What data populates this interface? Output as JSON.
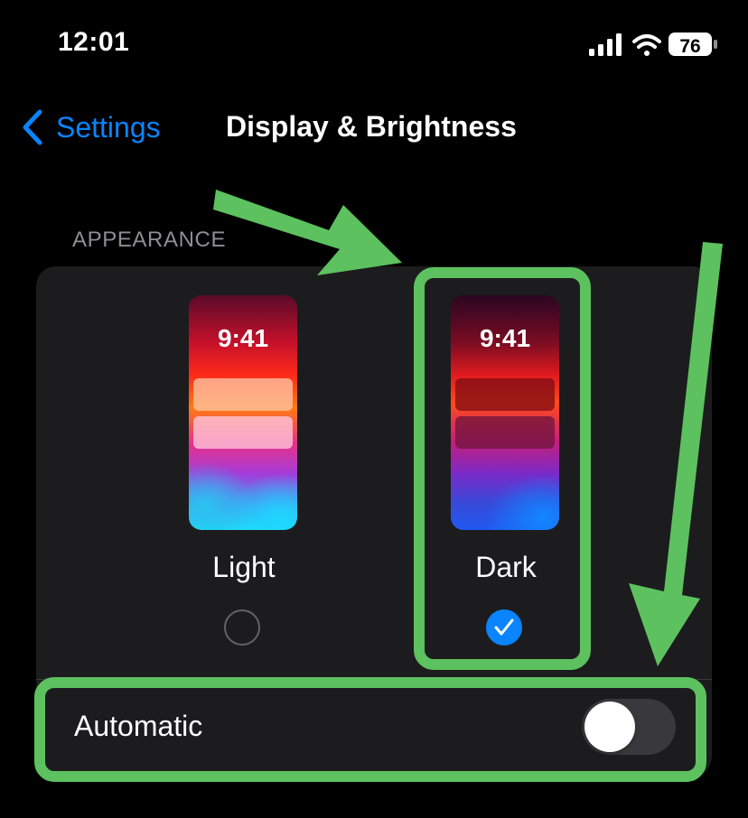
{
  "status_bar": {
    "time": "12:01",
    "battery": "76",
    "icons": [
      "signal-icon",
      "wifi-icon",
      "battery-icon"
    ]
  },
  "nav": {
    "back_label": "Settings",
    "title": "Display & Brightness"
  },
  "appearance": {
    "section_header": "APPEARANCE",
    "options": [
      {
        "label": "Light",
        "preview_time": "9:41",
        "selected": false
      },
      {
        "label": "Dark",
        "preview_time": "9:41",
        "selected": true
      }
    ],
    "automatic_label": "Automatic",
    "automatic_on": false
  },
  "colors": {
    "accent": "#0a84ff",
    "annotation": "#5cc15e",
    "background": "#000000",
    "card": "#1c1c1e"
  }
}
